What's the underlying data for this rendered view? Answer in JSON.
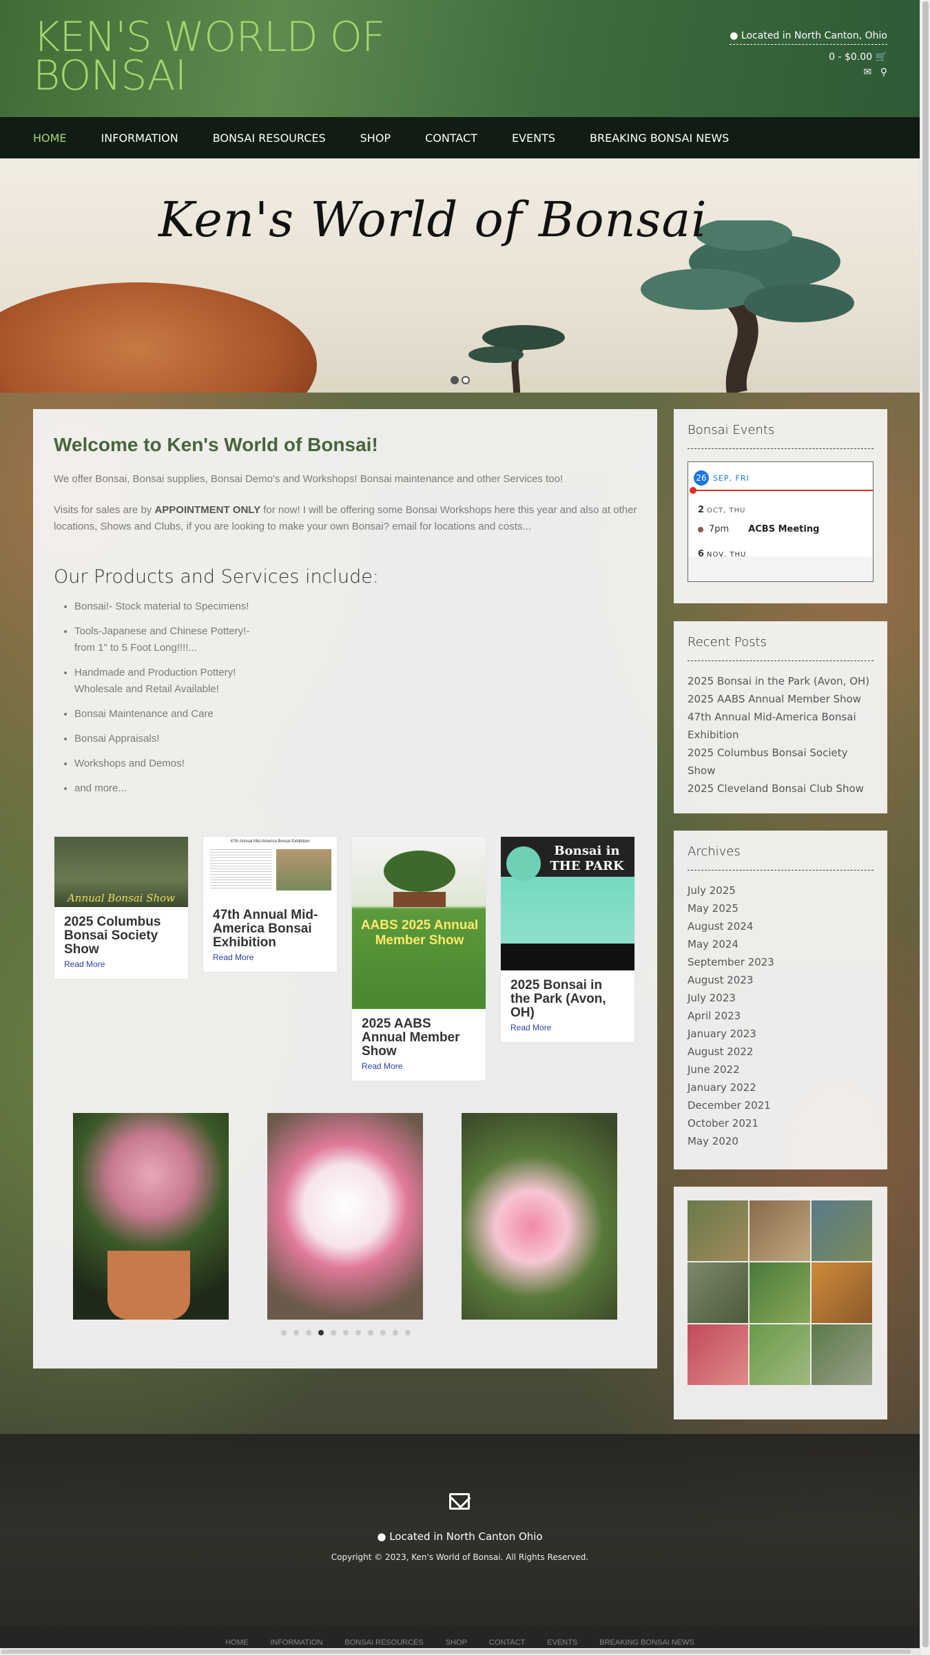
{
  "header": {
    "site_title": "KEN'S WORLD OF BONSAI",
    "location": "Located in North Canton, Ohio",
    "cart": "0 - $0.00"
  },
  "nav": {
    "items": [
      "HOME",
      "INFORMATION",
      "BONSAI RESOURCES",
      "SHOP",
      "CONTACT",
      "EVENTS",
      "BREAKING BONSAI NEWS"
    ]
  },
  "hero": {
    "title": "Ken's World of Bonsai"
  },
  "main": {
    "welcome": "Welcome to Ken's World of Bonsai!",
    "para1": "We offer Bonsai, Bonsai supplies, Bonsai Demo's and Workshops! Bonsai maintenance and other Services too!",
    "para2_before": "Visits for sales are by ",
    "para2_bold": "APPOINTMENT ONLY",
    "para2_after": " for now! I will be offering some Bonsai Workshops here this year and also at other locations, Shows and Clubs, if you are looking to make your own Bonsai? email for locations and costs...",
    "products_heading": "Our Products and Services include:",
    "products": [
      "Bonsai!- Stock material to Specimens!",
      "Tools-Japanese and Chinese Pottery!- from 1\" to 5 Foot Long!!!!...",
      "Handmade and Production Pottery! Wholesale and Retail Available!",
      "Bonsai Maintenance and Care",
      "Bonsai Appraisals!",
      "Workshops and Demos!",
      "and more..."
    ],
    "posts": [
      {
        "title": "2025 Columbus Bonsai Society Show",
        "more": "Read More",
        "thumb_text": "Annual Bonsai Show"
      },
      {
        "title": "47th Annual Mid-America Bonsai Exhibition",
        "more": "Read More",
        "thumb_text": "47th Annual Mid-America Bonsai Exhibition"
      },
      {
        "title": "2025 AABS Annual Member Show",
        "more": "Read More",
        "thumb_text": "AABS 2025 Annual Member Show"
      },
      {
        "title": "2025 Bonsai in the Park (Avon, OH)",
        "more": "Read More",
        "thumb_text": "Bonsai in THE PARK"
      }
    ]
  },
  "sidebar": {
    "events_title": "Bonsai Events",
    "calendar": {
      "today_num": "26",
      "today_label": "SEP, FRI",
      "next_num": "2",
      "next_label": "OCT, THU",
      "event_time": "7pm",
      "event_name": "ACBS Meeting",
      "after_num": "6",
      "after_label": "NOV, THU"
    },
    "recent_title": "Recent Posts",
    "recent": [
      "2025 Bonsai in the Park (Avon, OH)",
      "2025 AABS Annual Member Show",
      "47th Annual Mid-America Bonsai Exhibition",
      "2025 Columbus Bonsai Society Show",
      "2025 Cleveland Bonsai Club Show"
    ],
    "archives_title": "Archives",
    "archives": [
      "July 2025",
      "May 2025",
      "August 2024",
      "May 2024",
      "September 2023",
      "August 2023",
      "July 2023",
      "April 2023",
      "January 2023",
      "August 2022",
      "June 2022",
      "January 2022",
      "December 2021",
      "October 2021",
      "May 2020"
    ]
  },
  "footer": {
    "location": "Located in North Canton Ohio",
    "copyright": "Copyright © 2023, Ken's World of Bonsai. All Rights Reserved."
  },
  "icons": {
    "location": "map-marker-icon",
    "cart": "shopping-cart-icon",
    "mail": "envelope-icon",
    "search": "search-icon"
  },
  "colors": {
    "title_green": "#a6d66e",
    "nav_bg": "#111c14",
    "heading_green": "#46663b",
    "link_blue": "#2a3fa0"
  }
}
